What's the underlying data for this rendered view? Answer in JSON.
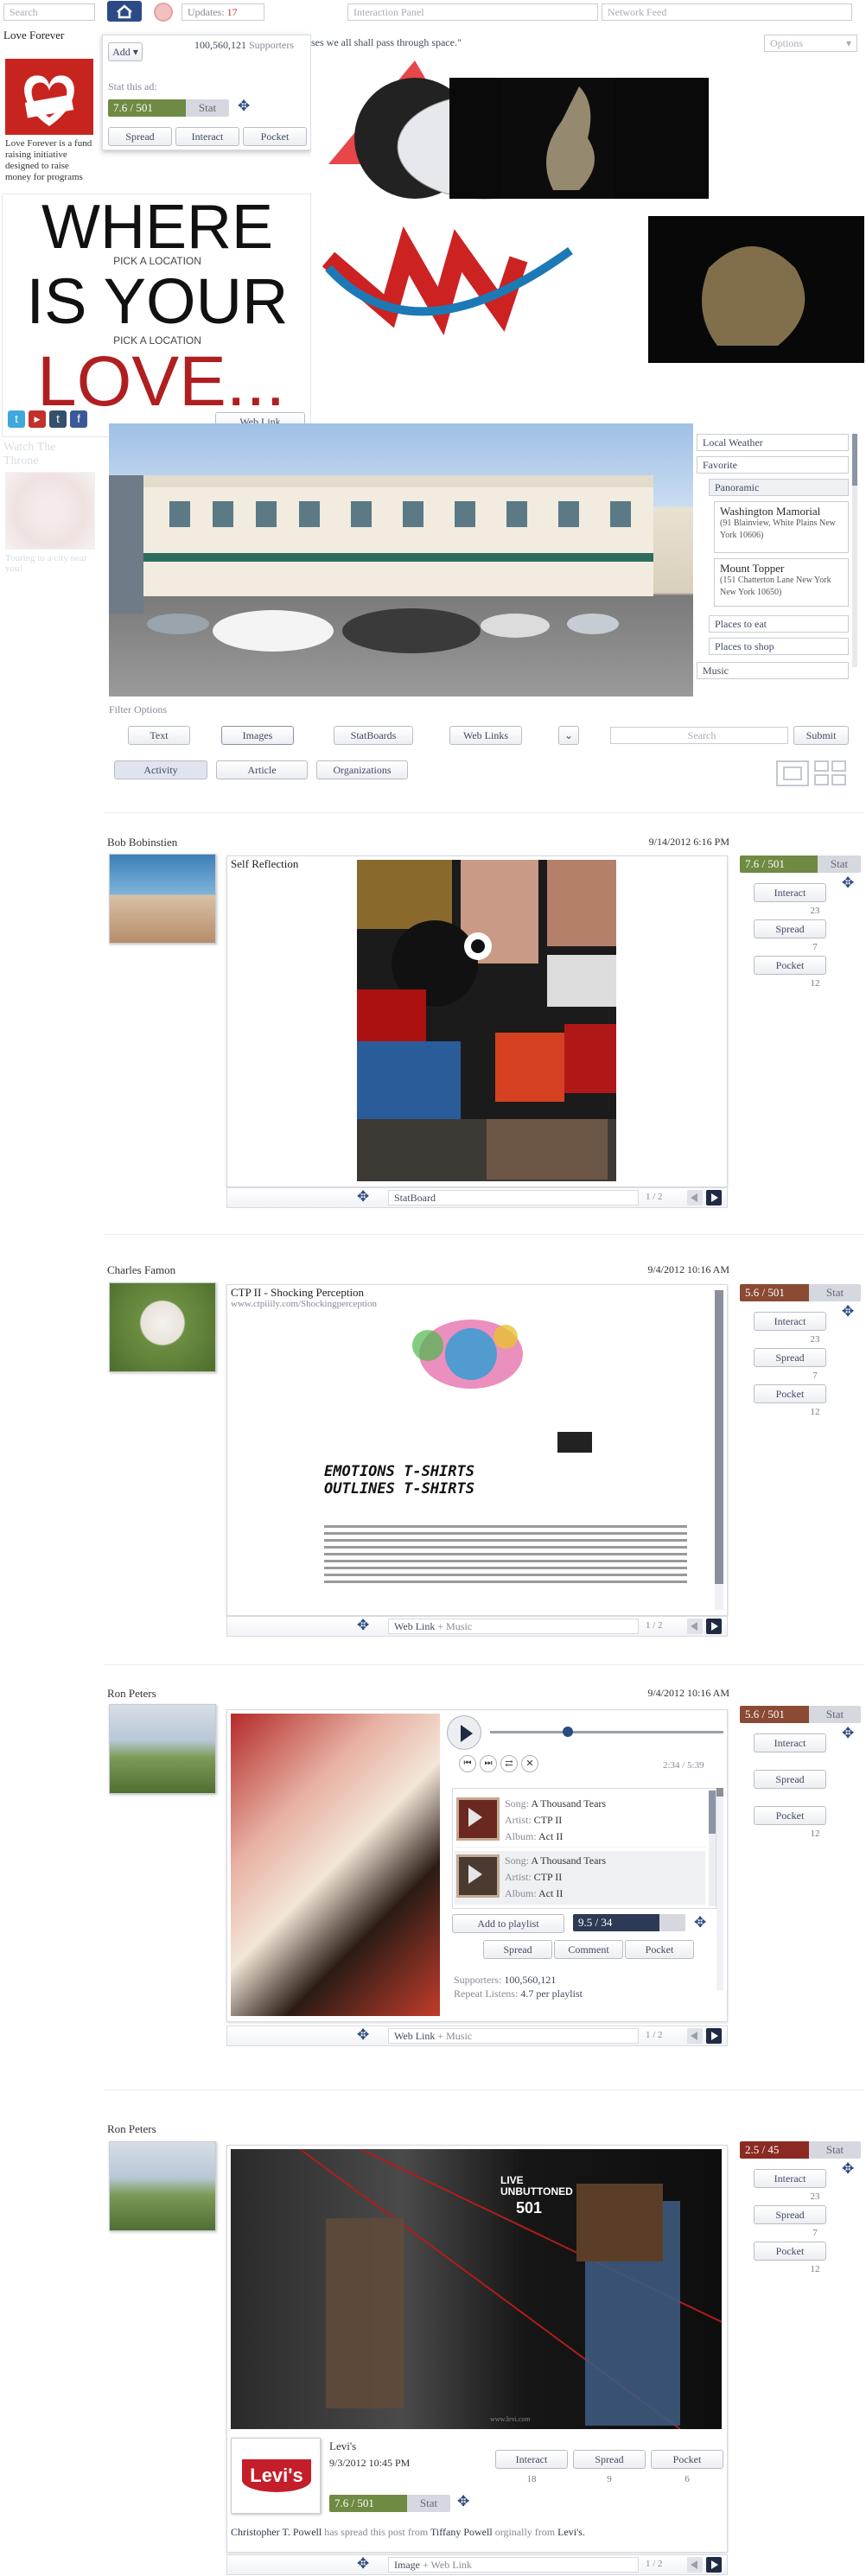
{
  "topbar": {
    "search_placeholder": "Search",
    "updates_label": "Updates:",
    "updates_count": "17",
    "interaction_panel": "Interaction Panel",
    "network_feed": "Network Feed"
  },
  "featured": {
    "title": "Love Forever",
    "add_label": "Add",
    "supporters_count": "100,560,121",
    "supporters_label": "Supporters",
    "stat_this_ad": "Stat this ad:",
    "stat_value": "7.6 / 501",
    "stat_label": "Stat",
    "spread": "Spread",
    "interact": "Interact",
    "pocket": "Pocket",
    "description": "Love Forever is a fund raising initiative designed to raise money for programs",
    "headline_1": "WHERE",
    "pick_1": "PICK A LOCATION",
    "headline_2": "IS YOUR",
    "pick_2": "PICK A LOCATION",
    "headline_3": "LOVE...",
    "weblink": "Web Link",
    "social_icons": [
      "twitter",
      "youtube",
      "tumblr",
      "facebook"
    ]
  },
  "quote": "ses we all shall pass through space.\"",
  "options_label": "Options",
  "sidebar_faded": {
    "title": "Watch The Throne",
    "caption": "Touring to a city near you!"
  },
  "location_panel": {
    "local_weather": "Local Weather",
    "favorite": "Favorite",
    "panoramic": "Panoramic",
    "places": [
      {
        "name": "Washington Mamorial",
        "address": "(91 Blainview, White Plains New York 10606)"
      },
      {
        "name": "Mount Topper",
        "address": "(151 Chatterton Lane New York New York 10650)"
      }
    ],
    "places_to_eat": "Places to eat",
    "places_to_shop": "Places to shop",
    "music": "Music"
  },
  "filter": {
    "label": "Filter Options",
    "buttons": [
      "Text",
      "Images",
      "StatBoards",
      "Web Links"
    ],
    "search_placeholder": "Search",
    "submit": "Submit",
    "tabs": [
      "Activity",
      "Article",
      "Organizations"
    ]
  },
  "posts": [
    {
      "author": "Bob Bobinstien",
      "date": "9/14/2012 6:16 PM",
      "title": "Self Reflection",
      "stat": "7.6 / 501",
      "stat_color": "#6f8a42",
      "interact": "Interact",
      "interact_count": "23",
      "spread": "Spread",
      "spread_count": "7",
      "pocket": "Pocket",
      "pocket_count": "12",
      "footer_type": "StatBoard",
      "footer_sub": "",
      "page": "1 / 2"
    },
    {
      "author": "Charles Famon",
      "date": "9/4/2012 10:16 AM",
      "title": "CTP II - Shocking Perception",
      "url": "www.ctpiiily.com/Shockingperception",
      "stat": "5.6 / 501",
      "stat_color": "#8a4a34",
      "interact": "Interact",
      "interact_count": "23",
      "spread": "Spread",
      "spread_count": "7",
      "pocket": "Pocket",
      "pocket_count": "12",
      "footer_type": "Web Link",
      "footer_sub": "Music",
      "page": "1 / 2",
      "site_heading_1": "EMOTIONS T-SHIRTS",
      "site_heading_2": "OUTLINES T-SHIRTS"
    },
    {
      "author": "Ron Peters",
      "date": "9/4/2012 10:16 AM",
      "stat": "5.6 / 501",
      "stat_color": "#8a4a34",
      "interact": "Interact",
      "interact_count": "",
      "spread": "Spread",
      "spread_count": "",
      "pocket": "Pocket",
      "pocket_count": "12",
      "footer_type": "Web Link",
      "footer_sub": "Music",
      "page": "1 / 2",
      "player_time": "2:34 / 5:39",
      "tracks": [
        {
          "song_label": "Song:",
          "song": "A Thousand Tears",
          "artist_label": "Artist:",
          "artist": "CTP II",
          "album_label": "Album:",
          "album": "Act II"
        },
        {
          "song_label": "Song:",
          "song": "A Thousand Tears",
          "artist_label": "Artist:",
          "artist": "CTP II",
          "album_label": "Album:",
          "album": "Act II"
        }
      ],
      "add_to_playlist": "Add to playlist",
      "playlist_stat": "9.5 / 34",
      "spread_btn": "Spread",
      "comment_btn": "Comment",
      "pocket_btn": "Pocket",
      "supporters_label": "Supporters:",
      "supporters": "100,560,121",
      "repeat_label": "Repeat Listens:",
      "repeat": "4.7 per playlist"
    },
    {
      "author": "Ron Peters",
      "stat": "2.5 / 45",
      "stat_color": "#8a2a22",
      "interact": "Interact",
      "interact_count": "23",
      "spread": "Spread",
      "spread_count": "7",
      "pocket": "Pocket",
      "pocket_count": "12",
      "ad_text_1": "LIVE UNBUTTONED",
      "ad_text_2": "501",
      "ad_url": "www.levi.com",
      "brand": "Levi's",
      "brand_logo": "Levi's",
      "brand_date": "9/3/2012 10:45 PM",
      "brand_interact": "Interact",
      "brand_interact_count": "18",
      "brand_spread": "Spread",
      "brand_spread_count": "9",
      "brand_pocket": "Pocket",
      "brand_pocket_count": "6",
      "brand_stat": "7.6 / 501",
      "spread_by": "Christopher T. Powell",
      "spread_text": "has spread this post from",
      "spread_from": "Tiffany Powell",
      "orig_text": "orginally from",
      "orig_from": "Levi's.",
      "footer_type": "Image",
      "footer_sub": "Web Link",
      "page": "1 / 2"
    }
  ]
}
